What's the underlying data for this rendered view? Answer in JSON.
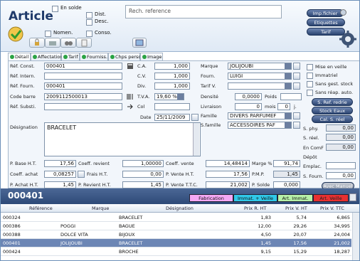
{
  "header": {
    "title": "Article",
    "en_solde": "En solde",
    "dist": "Dist.",
    "desc": "Desc.",
    "nomen": "Nomen.",
    "conso": "Conso.",
    "search_placeholder": "Rech. reference",
    "imp_fichier": "Imp.fichier",
    "etiquettes": "Etiquettes",
    "tarif": "Tarif"
  },
  "tabs": [
    "Détail",
    "Affectation",
    "Tarif",
    "Fourniss.",
    "Chps perso",
    "Image"
  ],
  "form": {
    "ref_const_label": "Réf. Const.",
    "ref_const": "000401",
    "ref_intern_label": "Réf. Intern.",
    "ref_intern": "",
    "ref_fourn_label": "Réf. Fourn.",
    "ref_fourn": "000401",
    "code_barre_label": "Code barre",
    "code_barre": "2009112500013",
    "ref_substi_label": "Réf. Substi.",
    "ref_substi": "",
    "designation_label": "Désignation",
    "designation": "BRACELET",
    "ca_label": "C.A.",
    "ca": "1,000",
    "cv_label": "C.V.",
    "cv": "1,000",
    "div_label": "Div.",
    "div": "1,000",
    "tva_label": "T.V.A.",
    "tva": "19,60 %",
    "col_label": "Col",
    "col": "",
    "date_label": "Date",
    "date": "25/11/2009",
    "marque_label": "Marque",
    "marque": "JOLIJOUBI",
    "fourn_label": "Fourn.",
    "fourn": "LUIGI",
    "tarifv_label": "Tarif V.",
    "tarifv": "",
    "densite_label": "Densité",
    "densite": "0,0000",
    "poids_label": "Poids",
    "poids": "",
    "livraison_label": "Livraison",
    "livraison": "0",
    "mois_label": "mois",
    "mois": "0",
    "j_label": "j.",
    "famille_label": "Famille",
    "famille": "DIVERS PARFUMEF",
    "sfamille_label": "S.famille",
    "sfamille": "ACCESSOIRES PAF",
    "mise_en_veille": "Mise en veille",
    "immatriel": "Immatriel",
    "sans_gest": "Sans gest. stock",
    "sans_reap": "Sans réap. auto.",
    "s_ref_redrie": "S. Ref. redrie",
    "stock_eaux": "Stock Eaux",
    "cal_sreel": "Cal. S. réel",
    "s_phy_label": "S. phy.",
    "s_phy": "0,00",
    "s_reel_label": "S. réel.",
    "s_reel": "0,00",
    "en_comf_label": "En ComF",
    "en_comf": "0,00",
    "depot_label": "Dépôt",
    "emplac_label": "Emplac.",
    "s_fourn_label": "S. Fourn.",
    "s_fourn": "0,00",
    "avec_manuel": "Avec Manuel",
    "pbase_label": "P. Base H.T.",
    "pbase": "17,56",
    "coeff_revient_label": "Coeff. revient",
    "coeff_revient": "1,00000",
    "coeff_vente_label": "Coeff. vente",
    "coeff_vente": "14,48414",
    "marge_label": "Marge %",
    "marge": "91,74",
    "coeff_achat_label": "Coeff. achat",
    "coeff_achat": "0,08257",
    "frais_label": "Frais H.T.",
    "frais": "0,00",
    "pvente_ht_label": "P. Vente H.T.",
    "pvente_ht": "17,56",
    "pmp_label": "P.M.P.",
    "pmp": "1,45",
    "pachat_label": "P. Achat H.T.",
    "pachat": "1,45",
    "previent_label": "P. Revient H.T.",
    "previent": "1,45",
    "pvente_ttc_label": "P. Vente T.T.C.",
    "pvente_ttc": "21,002",
    "psolde_label": "P. Solde",
    "psolde": "0,000"
  },
  "grid": {
    "current_code": "000401",
    "legend": {
      "fabrication": "Fabrication",
      "immat_veille": "Immat. + Veille",
      "art_immat": "Art. Immat.",
      "art_veille": "Art. Veille"
    },
    "columns": [
      "Référence",
      "Marque",
      "Désignation",
      "Prix R. HT",
      "Prix V. HT",
      "Prix V. TTC"
    ],
    "rows": [
      {
        "ref": "000324",
        "marque": "",
        "design": "BRACELET",
        "prht": "1,83",
        "pvht": "5,74",
        "pvttc": "6,865"
      },
      {
        "ref": "000386",
        "marque": "POGGI",
        "design": "BAGUE",
        "prht": "12,00",
        "pvht": "29,26",
        "pvttc": "34,995"
      },
      {
        "ref": "000388",
        "marque": "DOLCE VITA",
        "design": "BIJOUX",
        "prht": "4,50",
        "pvht": "20,07",
        "pvttc": "24,004"
      },
      {
        "ref": "000401",
        "marque": "JOLIJOUBI",
        "design": "BRACELET",
        "prht": "1,45",
        "pvht": "17,56",
        "pvttc": "21,002"
      },
      {
        "ref": "000424",
        "marque": "",
        "design": "BROCHE",
        "prht": "9,15",
        "pvht": "15,29",
        "pvttc": "18,287"
      }
    ]
  },
  "colors": {
    "fabrication": "#f4a8f4",
    "immat_veille": "#30c8e8",
    "art_immat": "#b6f0a8",
    "art_veille": "#e83030",
    "selected": "#6c86b5"
  }
}
